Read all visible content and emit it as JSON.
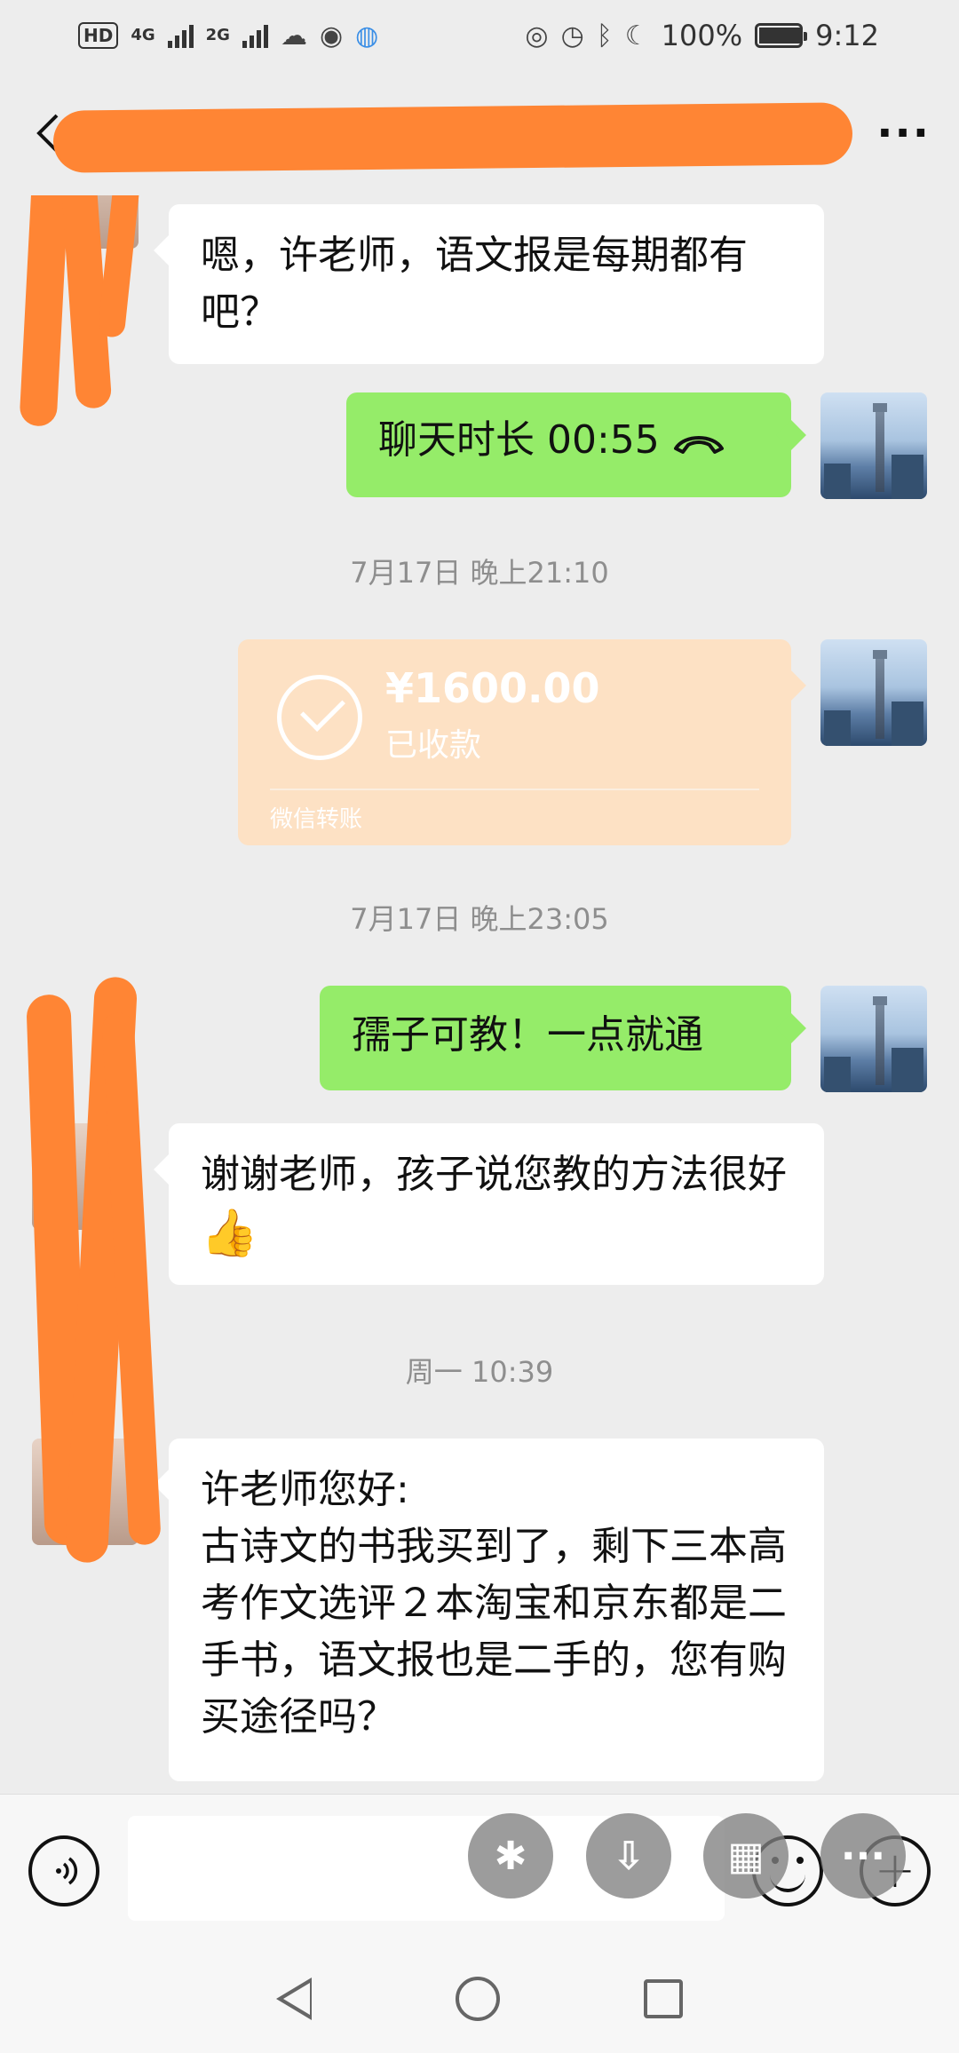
{
  "status_bar": {
    "hd_label": "HD",
    "network_1": "4G",
    "network_2": "2G",
    "battery": "100%",
    "battery_level": 1.0,
    "time": "9:12"
  },
  "title_bar": {
    "more_label": "···"
  },
  "messages": {
    "m1_text": "嗯，许老师，语文报是每期都有吧？",
    "m2_text": "聊天时长 00:55",
    "ts1": "7月17日 晚上21:10",
    "transfer_amount": "¥1600.00",
    "transfer_status": "已收款",
    "transfer_label": "微信转账",
    "ts2": "7月17日 晚上23:05",
    "m3_text": "孺子可教！一点就通",
    "m4_text": "谢谢老师，孩子说您教的方法很好",
    "ts3": "周一 10:39",
    "m5_line1": "许老师您好:",
    "m5_text": "古诗文的书我买到了，剩下三本高考作文选评２本淘宝和京东都是二手书，语文报也是二手的，您有购买途径吗？"
  },
  "colors": {
    "background": "#ededed",
    "green_bubble": "#95ec69",
    "white_bubble": "#ffffff",
    "transfer_bubble": "#fde1c4",
    "redaction": "#ff8534",
    "timestamp": "#8e8e8e"
  },
  "icons": {
    "back": "chevron-left-icon",
    "more": "more-dots-icon",
    "call": "phone-hangup-icon",
    "voice": "voice-input-icon",
    "emoji": "emoji-icon",
    "plus": "plus-icon"
  }
}
